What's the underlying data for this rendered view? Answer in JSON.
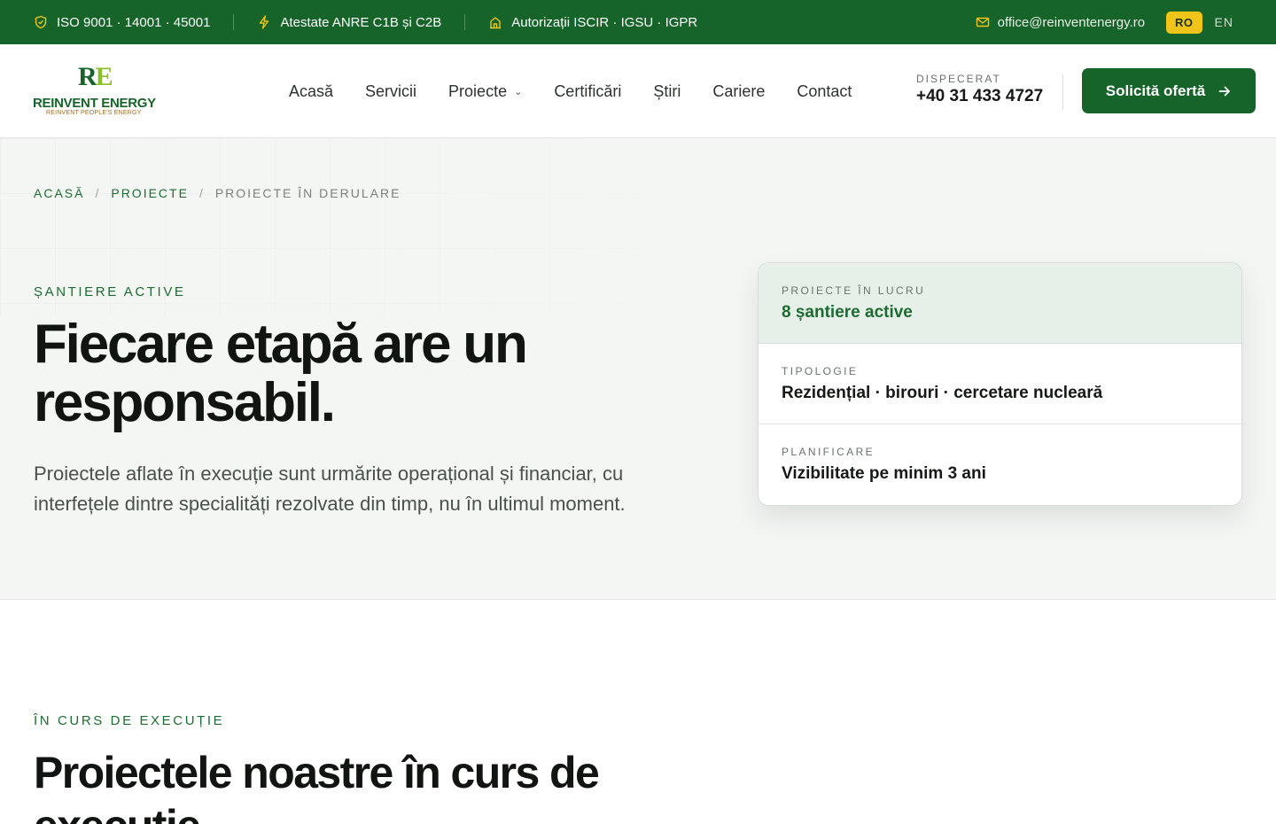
{
  "topbar": {
    "items": [
      {
        "icon": "shield-check-icon",
        "label": "ISO 9001 · 14001 · 45001"
      },
      {
        "icon": "lightning-icon",
        "label": "Atestate ANRE C1B și C2B"
      },
      {
        "icon": "building-icon",
        "label": "Autorizații ISCIR · IGSU · IGPR"
      }
    ],
    "email": "office@reinventenergy.ro",
    "lang_active": "RO",
    "lang_other": "EN"
  },
  "header": {
    "logo_mark": "RE",
    "logo_name": "REINVENT ENERGY",
    "logo_tagline": "REINVENT PEOPLE'S ENERGY",
    "nav": [
      "Acasă",
      "Servicii",
      "Proiecte",
      "Certificări",
      "Știri",
      "Cariere",
      "Contact"
    ],
    "dispatch_label": "DISPECERAT",
    "dispatch_phone": "+40 31 433 4727",
    "cta_label": "Solicită ofertă"
  },
  "hero": {
    "breadcrumb": [
      "ACASĂ",
      "PROIECTE",
      "PROIECTE ÎN DERULARE"
    ],
    "eyebrow": "ȘANTIERE ACTIVE",
    "title_line1": "Fiecare etapă are un",
    "title_highlight": "responsabil.",
    "lead": "Proiectele aflate în execuție sunt urmărite operațional și financiar, cu interfețele dintre specialități rezolvate din timp, nu în ultimul moment.",
    "card": [
      {
        "label": "PROIECTE ÎN LUCRU",
        "value": "8 șantiere active"
      },
      {
        "label": "TIPOLOGIE",
        "value": "Rezidențial · birouri · cercetare nucleară"
      },
      {
        "label": "PLANIFICARE",
        "value": "Vizibilitate pe minim 3 ani"
      }
    ]
  },
  "section": {
    "eyebrow": "ÎN CURS DE EXECUȚIE",
    "title": "Proiectele noastre în curs de execuție"
  },
  "colors": {
    "brand_green": "#16642a",
    "accent_yellow": "#e6c21c",
    "hero_bg": "#f4f6f4"
  }
}
